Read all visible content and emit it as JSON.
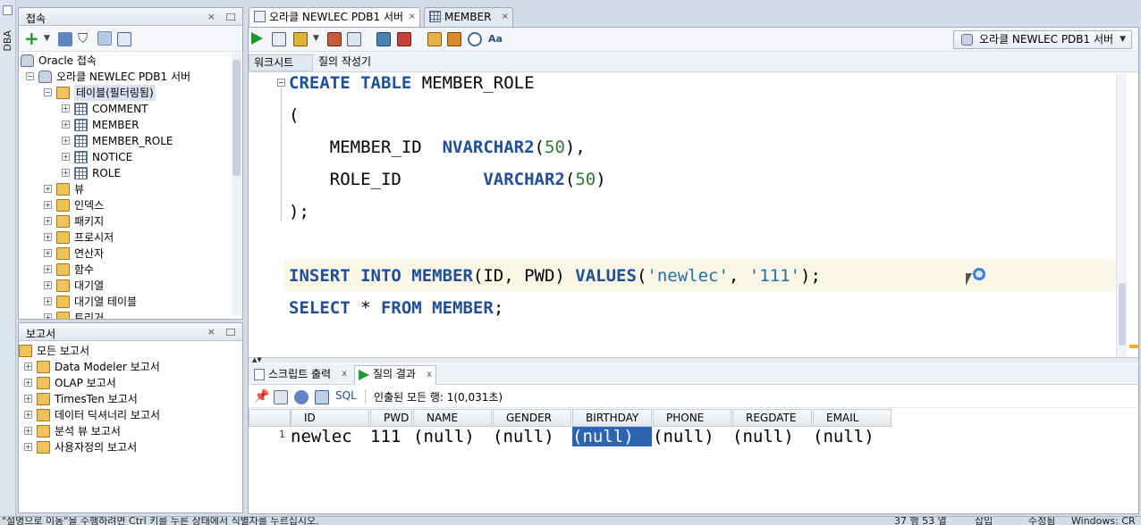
{
  "side": {
    "dba_label": "DBA"
  },
  "connections": {
    "title": "접속",
    "tree": [
      {
        "label": "Oracle 접속",
        "level": 0
      },
      {
        "label": "오라클 NEWLEC PDB1 서버",
        "level": 1
      },
      {
        "label": "테이블(필터링됨)",
        "level": 2
      },
      {
        "label": "COMMENT",
        "level": 3
      },
      {
        "label": "MEMBER",
        "level": 3
      },
      {
        "label": "MEMBER_ROLE",
        "level": 3
      },
      {
        "label": "NOTICE",
        "level": 3
      },
      {
        "label": "ROLE",
        "level": 3
      },
      {
        "label": "뷰",
        "level": 2
      },
      {
        "label": "인덱스",
        "level": 2
      },
      {
        "label": "패키지",
        "level": 2
      },
      {
        "label": "프로시저",
        "level": 2
      },
      {
        "label": "연산자",
        "level": 2
      },
      {
        "label": "함수",
        "level": 2
      },
      {
        "label": "대기열",
        "level": 2
      },
      {
        "label": "대기열 테이블",
        "level": 2
      },
      {
        "label": "트리거",
        "level": 2
      }
    ]
  },
  "reports": {
    "title": "보고서",
    "tree": [
      {
        "label": "모든 보고서",
        "level": 0
      },
      {
        "label": "Data Modeler 보고서",
        "level": 1
      },
      {
        "label": "OLAP 보고서",
        "level": 1
      },
      {
        "label": "TimesTen 보고서",
        "level": 1
      },
      {
        "label": "데이터 딕셔너리 보고서",
        "level": 1
      },
      {
        "label": "분석 뷰 보고서",
        "level": 1
      },
      {
        "label": "사용자정의 보고서",
        "level": 1
      }
    ]
  },
  "tabs": [
    {
      "label": "오라클 NEWLEC PDB1 서버"
    },
    {
      "label": "MEMBER"
    }
  ],
  "connection_select": {
    "value": "오라클 NEWLEC PDB1 서버"
  },
  "subtabs": {
    "worksheet": "워크시트",
    "query_builder": "질의 작성기"
  },
  "editor": {
    "lines": [
      "CREATE TABLE MEMBER_ROLE",
      "(",
      "    MEMBER_ID  NVARCHAR2(50),",
      "    ROLE_ID        VARCHAR2(50)",
      ");",
      "",
      "INSERT INTO MEMBER(ID, PWD) VALUES('newlec', '111');",
      "SELECT * FROM MEMBER;"
    ]
  },
  "result_tabs": {
    "script_output": "스크립트 출력",
    "query_result": "질의 결과"
  },
  "result_toolbar": {
    "sql_label": "SQL",
    "status": "인출된 모든 행: 1(0,031초)"
  },
  "grid": {
    "columns": [
      "ID",
      "PWD",
      "NAME",
      "GENDER",
      "BIRTHDAY",
      "PHONE",
      "REGDATE",
      "EMAIL"
    ],
    "rows": [
      {
        "num": "1",
        "cells": [
          "newlec",
          "111",
          "(null)",
          "(null)",
          "(null)",
          "(null)",
          "(null)",
          "(null)"
        ]
      }
    ]
  },
  "status_bar": {
    "hint": "\"설명으로 이동\"을 수행하려면 Ctrl 키를 누른 상태에서 식별자를 누르십시오.",
    "position": "37 행 53 열",
    "insert": "삽입",
    "modified": "수정됨",
    "os": "Windows: CR"
  }
}
